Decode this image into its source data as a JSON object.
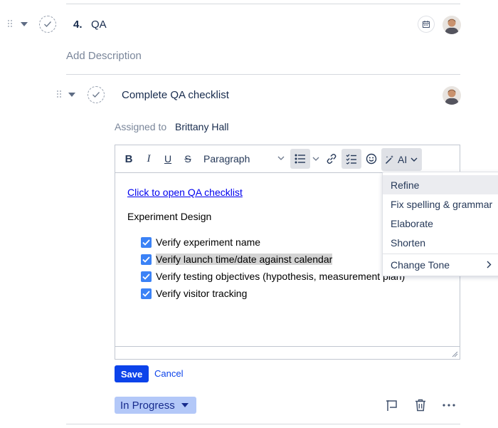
{
  "section": {
    "number": "4.",
    "title": "QA",
    "add_description": "Add Description"
  },
  "task": {
    "title": "Complete QA checklist",
    "assigned_label": "Assigned to",
    "assignee": "Brittany Hall"
  },
  "toolbar": {
    "bold": "B",
    "italic": "I",
    "underline": "U",
    "strike": "S",
    "paragraph": "Paragraph",
    "ai": "AI"
  },
  "editor": {
    "link_text": "Click to open QA checklist",
    "heading": "Experiment Design",
    "checklist": [
      {
        "label": "Verify experiment name",
        "checked": true
      },
      {
        "label": "Verify launch time/date against calendar",
        "checked": true
      },
      {
        "label": "Verify testing objectives (hypothesis, measurement plan)",
        "checked": true
      },
      {
        "label": "Verify visitor tracking",
        "checked": true
      }
    ]
  },
  "ai_menu": {
    "items": [
      "Refine",
      "Fix spelling & grammar",
      "Elaborate",
      "Shorten",
      "Change Tone"
    ]
  },
  "actions": {
    "save": "Save",
    "cancel": "Cancel",
    "status": "In Progress"
  },
  "colors": {
    "primary_button": "#0c43ea",
    "link": "#0000ee",
    "status_badge": "#b3c8f8",
    "checkbox": "#3b82f6",
    "highlight": "#d4d4d4"
  }
}
